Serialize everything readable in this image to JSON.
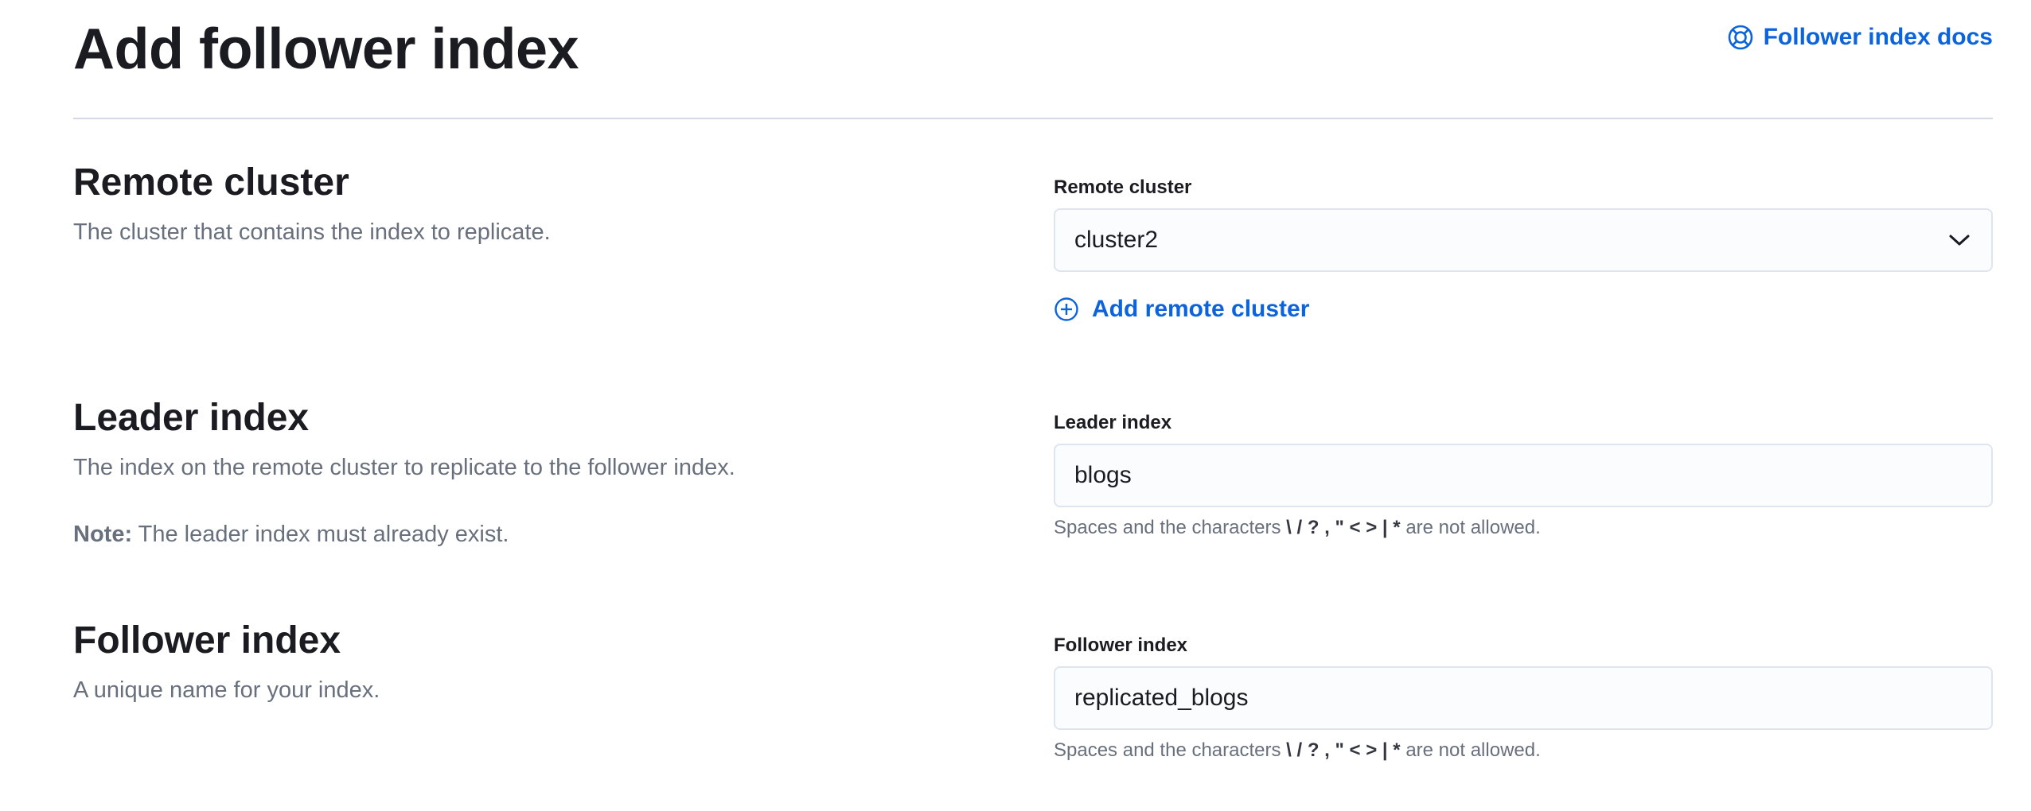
{
  "header": {
    "title": "Add follower index",
    "docs_link": "Follower index docs",
    "docs_icon": "lifebuoy-icon"
  },
  "remote_cluster": {
    "title": "Remote cluster",
    "description": "The cluster that contains the index to replicate.",
    "field_label": "Remote cluster",
    "selected_value": "cluster2",
    "add_link": "Add remote cluster",
    "add_icon": "plus-in-circle-icon"
  },
  "leader_index": {
    "title": "Leader index",
    "description": "The index on the remote cluster to replicate to the follower index.",
    "note_label": "Note:",
    "note_text": " The leader index must already exist.",
    "field_label": "Leader index",
    "value": "blogs",
    "help_prefix": "Spaces and the characters ",
    "help_chars": "\\ / ? , \" < > | *",
    "help_suffix": " are not allowed."
  },
  "follower_index": {
    "title": "Follower index",
    "description": "A unique name for your index.",
    "field_label": "Follower index",
    "value": "replicated_blogs",
    "help_prefix": "Spaces and the characters ",
    "help_chars": "\\ / ? , \" < > | *",
    "help_suffix": " are not allowed."
  },
  "colors": {
    "link": "#0b64dd",
    "text": "#1a1c21",
    "subdued": "#69707d",
    "border": "#dfe5ef"
  }
}
